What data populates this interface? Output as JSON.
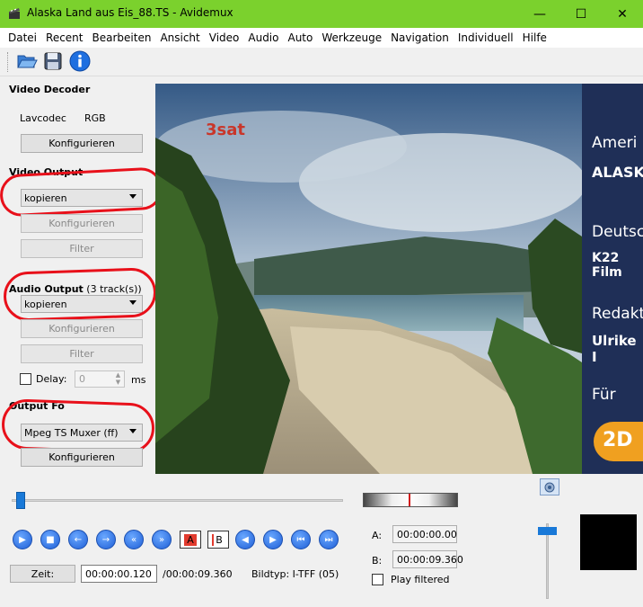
{
  "window": {
    "title": "Alaska Land aus Eis_88.TS - Avidemux",
    "minimize": "—",
    "maximize": "☐",
    "close": "✕"
  },
  "menu": [
    "Datei",
    "Recent",
    "Bearbeiten",
    "Ansicht",
    "Video",
    "Audio",
    "Auto",
    "Werkzeuge",
    "Navigation",
    "Individuell",
    "Hilfe"
  ],
  "toolbar": {
    "open_icon": "folder-open-icon",
    "save_icon": "save-icon",
    "info_icon": "info-icon"
  },
  "video_decoder": {
    "title": "Video Decoder",
    "codec": "Lavcodec",
    "format": "RGB",
    "configure": "Konfigurieren"
  },
  "video_output": {
    "title": "Video Output",
    "selected": "kopieren",
    "configure": "Konfigurieren",
    "filter": "Filter"
  },
  "audio_output": {
    "title": "Audio Output",
    "tracks": "(3 track(s))",
    "selected": "kopieren",
    "configure": "Konfigurieren",
    "filter": "Filter",
    "delay_label": "Delay:",
    "delay_value": "0",
    "delay_unit": "ms"
  },
  "output_format": {
    "title": "Output Fo",
    "selected": "Mpeg TS Muxer (ff)",
    "configure": "Konfigurieren"
  },
  "video_frame": {
    "logo": "3sat",
    "credits": [
      "Ameri",
      "ALASKA",
      "Deutsch",
      "K22 Film",
      "Redaktic",
      "Ulrike I",
      "Für",
      "2D"
    ]
  },
  "navigation": {
    "seek_position": 0.013,
    "buttons": [
      "play",
      "stop",
      "previous-frame",
      "next-frame",
      "rewind",
      "fast-forward",
      "set-marker-a",
      "set-marker-b",
      "previous-keyframe",
      "next-keyframe",
      "go-to-start",
      "go-to-end"
    ],
    "marker_a": "A",
    "marker_b": "B",
    "time_button": "Zeit:",
    "current_time": "00:00:00.120",
    "total_time": "/00:00:09.360",
    "frame_type": "Bildtyp: I-TFF (05)",
    "a_label": "A:",
    "a_time": "00:00:00.00",
    "b_label": "B:",
    "b_time": "00:00:09.360",
    "play_filtered": "Play filtered",
    "volume_level": 0.1
  }
}
